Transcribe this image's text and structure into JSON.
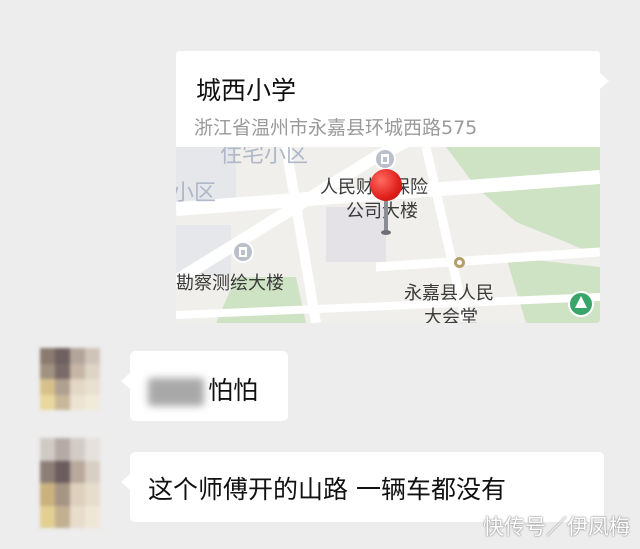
{
  "location_card": {
    "title": "城西小学",
    "address": "浙江省温州市永嘉县环城西路575",
    "map_labels": {
      "district_partial": "小区",
      "top_partial": "住宅小区",
      "insurance_line1": "人民财产保险",
      "insurance_line2": "公司大楼",
      "survey_building": "勘察测绘大楼",
      "hall_line1": "永嘉县人民",
      "hall_line2": "大会堂"
    }
  },
  "messages": [
    {
      "sender": "contact",
      "text": "怕怕",
      "name_blurred": true
    },
    {
      "sender": "contact",
      "text": "这个师傅开的山路  一辆车都没有"
    }
  ],
  "watermark": "快传号／伊凤梅"
}
